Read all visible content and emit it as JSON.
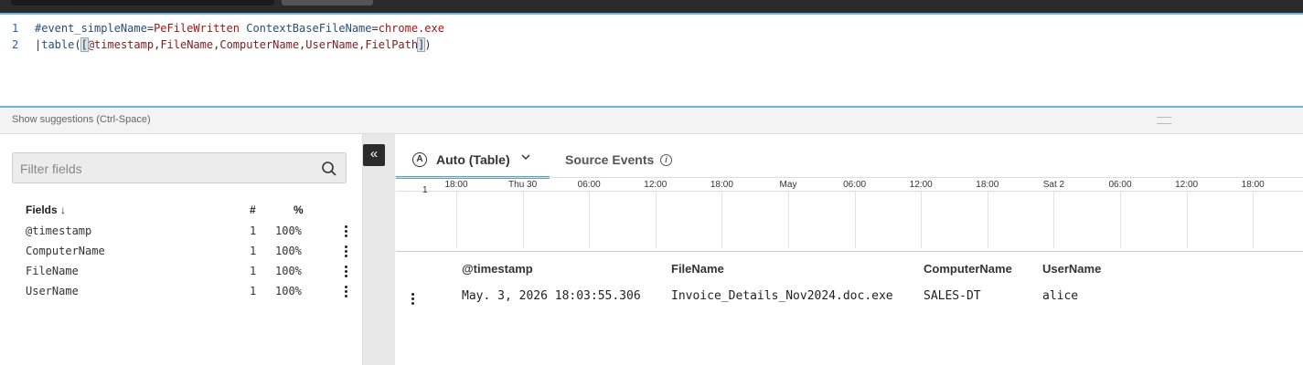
{
  "editor": {
    "lines": [
      {
        "num": "1",
        "tokens": [
          {
            "t": "#event_simpleName",
            "c": "key"
          },
          {
            "t": "=",
            "c": "op"
          },
          {
            "t": "PeFileWritten",
            "c": "val"
          },
          {
            "t": " ",
            "c": "op"
          },
          {
            "t": "ContextBaseFileName",
            "c": "key"
          },
          {
            "t": "=",
            "c": "op"
          },
          {
            "t": "chrome.exe",
            "c": "val"
          }
        ]
      },
      {
        "num": "2",
        "tokens": [
          {
            "t": "|",
            "c": "op"
          },
          {
            "t": "table",
            "c": "fn"
          },
          {
            "t": "(",
            "c": "op"
          },
          {
            "t": "[",
            "c": "box"
          },
          {
            "t": "@timestamp",
            "c": "field"
          },
          {
            "t": ",",
            "c": "op"
          },
          {
            "t": "FileName",
            "c": "field"
          },
          {
            "t": ",",
            "c": "op"
          },
          {
            "t": "ComputerName",
            "c": "field"
          },
          {
            "t": ",",
            "c": "op"
          },
          {
            "t": "UserName",
            "c": "field"
          },
          {
            "t": ",",
            "c": "op"
          },
          {
            "t": "FielPath",
            "c": "field"
          },
          {
            "t": "]",
            "c": "box"
          },
          {
            "t": ")",
            "c": "op"
          }
        ]
      }
    ]
  },
  "suggestions_hint": "Show suggestions (Ctrl-Space)",
  "fields_panel": {
    "search_placeholder": "Filter fields",
    "header": {
      "fields": "Fields",
      "count": "#",
      "percent": "%"
    },
    "sort_indicator": "↓",
    "rows": [
      {
        "name": "@timestamp",
        "count": "1",
        "percent": "100%"
      },
      {
        "name": "ComputerName",
        "count": "1",
        "percent": "100%"
      },
      {
        "name": "FileName",
        "count": "1",
        "percent": "100%"
      },
      {
        "name": "UserName",
        "count": "1",
        "percent": "100%"
      }
    ]
  },
  "collapse_label": "«",
  "tabs": {
    "auto": {
      "label": "Auto (Table)",
      "icon": "A"
    },
    "source": {
      "label": "Source Events",
      "icon": "i"
    }
  },
  "timeline": {
    "y_label": "1",
    "ticks": [
      "18:00",
      "Thu 30",
      "06:00",
      "12:00",
      "18:00",
      "May",
      "06:00",
      "12:00",
      "18:00",
      "Sat 2",
      "06:00",
      "12:00",
      "18:00"
    ]
  },
  "results_table": {
    "columns": [
      "@timestamp",
      "FileName",
      "ComputerName",
      "UserName"
    ],
    "rows": [
      [
        "May. 3, 2026 18:03:55.306",
        "Invoice_Details_Nov2024.doc.exe",
        "SALES-DT",
        "alice"
      ]
    ]
  },
  "colors": {
    "accent": "#5aa3c6",
    "topbar": "#2b2b2b"
  }
}
